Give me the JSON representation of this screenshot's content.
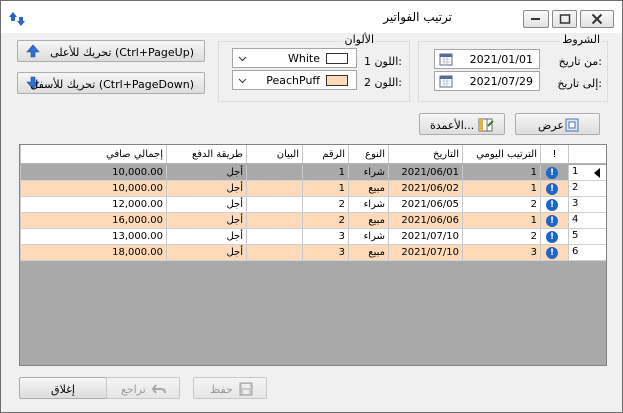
{
  "window": {
    "title": "ترتيب الفواتير"
  },
  "move_buttons": {
    "up_label": "تحريك للأعلى (Ctrl+PageUp)",
    "down_label": "تحريك للأسفل (Ctrl+PageDown)"
  },
  "colors_group": {
    "title": "الألوان",
    "color1_label": "اللون 1:",
    "color1_name": "White",
    "color1_hex": "#ffffff",
    "color2_label": "اللون 2:",
    "color2_name": "PeachPuff",
    "color2_hex": "#ffdab9"
  },
  "conditions_group": {
    "title": "الشروط",
    "from_label": "من تاريخ:",
    "from_value": "2021/01/01",
    "to_label": "إلى تاريخ:",
    "to_value": "2021/07/29"
  },
  "actions": {
    "columns_label": "الأعمدة...",
    "view_label": "عرض"
  },
  "grid": {
    "headers": {
      "mark": "!",
      "daily_order": "الترتيب اليومي",
      "date": "التاريخ",
      "type": "النوع",
      "number": "الرقم",
      "statement": "البيان",
      "payment": "طريقة الدفع",
      "net_total": "إجمالي صافي"
    },
    "rows": [
      {
        "num": "1",
        "daily_order": "1",
        "date": "2021/06/01",
        "type": "شراء",
        "number": "1",
        "statement": "",
        "payment": "أجل",
        "net_total": "10,000.00",
        "selected": true
      },
      {
        "num": "2",
        "daily_order": "1",
        "date": "2021/06/02",
        "type": "مبيع",
        "number": "1",
        "statement": "",
        "payment": "أجل",
        "net_total": "10,000.00"
      },
      {
        "num": "3",
        "daily_order": "2",
        "date": "2021/06/05",
        "type": "شراء",
        "number": "2",
        "statement": "",
        "payment": "أجل",
        "net_total": "12,000.00"
      },
      {
        "num": "4",
        "daily_order": "1",
        "date": "2021/06/06",
        "type": "مبيع",
        "number": "2",
        "statement": "",
        "payment": "أجل",
        "net_total": "16,000.00"
      },
      {
        "num": "5",
        "daily_order": "2",
        "date": "2021/07/10",
        "type": "شراء",
        "number": "3",
        "statement": "",
        "payment": "أجل",
        "net_total": "13,000.00"
      },
      {
        "num": "6",
        "daily_order": "3",
        "date": "2021/07/10",
        "type": "مبيع",
        "number": "3",
        "statement": "",
        "payment": "أجل",
        "net_total": "18,000.00"
      }
    ]
  },
  "footer": {
    "close_label": "إغلاق",
    "undo_label": "تراجع",
    "save_label": "حفظ"
  }
}
